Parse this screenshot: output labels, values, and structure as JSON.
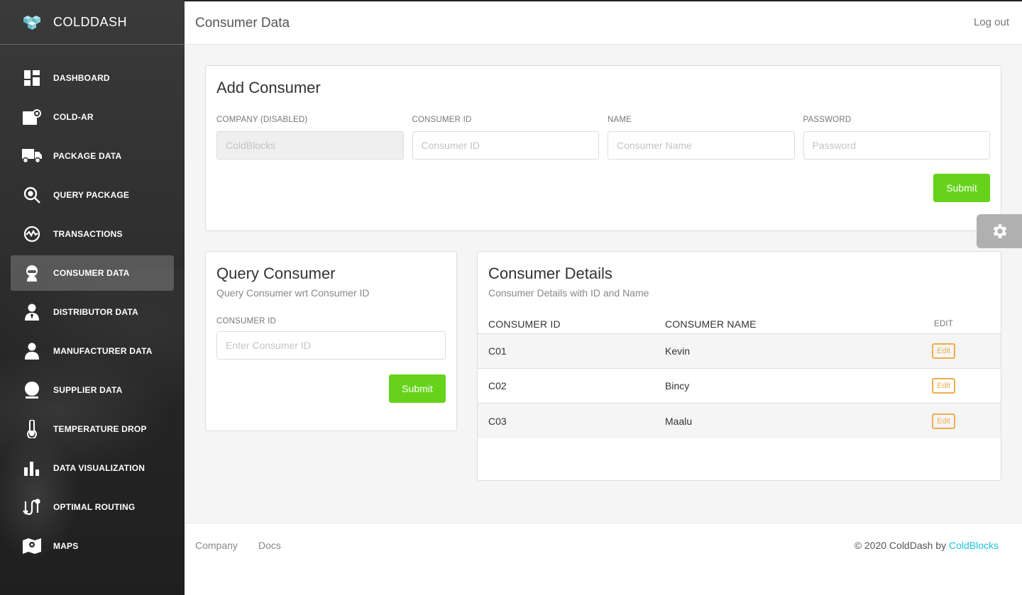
{
  "brand": {
    "name": "COLDDASH"
  },
  "sidebar": {
    "items": [
      {
        "label": "DASHBOARD",
        "icon": "dashboard-icon",
        "active": false
      },
      {
        "label": "COLD-AR",
        "icon": "ar-icon",
        "active": false
      },
      {
        "label": "PACKAGE DATA",
        "icon": "truck-icon",
        "active": false
      },
      {
        "label": "QUERY PACKAGE",
        "icon": "search-icon",
        "active": false
      },
      {
        "label": "TRANSACTIONS",
        "icon": "transactions-icon",
        "active": false
      },
      {
        "label": "CONSUMER DATA",
        "icon": "consumer-icon",
        "active": true
      },
      {
        "label": "DISTRIBUTOR DATA",
        "icon": "distributor-icon",
        "active": false
      },
      {
        "label": "MANUFACTURER DATA",
        "icon": "manufacturer-icon",
        "active": false
      },
      {
        "label": "SUPPLIER DATA",
        "icon": "supplier-icon",
        "active": false
      },
      {
        "label": "TEMPERATURE DROP",
        "icon": "thermometer-icon",
        "active": false
      },
      {
        "label": "DATA VISUALIZATION",
        "icon": "bar-chart-icon",
        "active": false
      },
      {
        "label": "OPTIMAL ROUTING",
        "icon": "routing-icon",
        "active": false
      },
      {
        "label": "MAPS",
        "icon": "map-icon",
        "active": false
      }
    ]
  },
  "header": {
    "title": "Consumer Data",
    "logout": "Log out"
  },
  "add_consumer": {
    "title": "Add Consumer",
    "fields": {
      "company": {
        "label": "COMPANY (DISABLED)",
        "placeholder": "ColdBlocks"
      },
      "consumer_id": {
        "label": "CONSUMER ID",
        "placeholder": "Consumer ID"
      },
      "name": {
        "label": "NAME",
        "placeholder": "Consumer Name"
      },
      "password": {
        "label": "PASSWORD",
        "placeholder": "Password"
      }
    },
    "submit": "Submit"
  },
  "query_consumer": {
    "title": "Query Consumer",
    "subtitle": "Query Consumer wrt Consumer ID",
    "field_label": "CONSUMER ID",
    "placeholder": "Enter Consumer ID",
    "submit": "Submit"
  },
  "consumer_details": {
    "title": "Consumer Details",
    "subtitle": "Consumer Details with ID and Name",
    "columns": [
      "CONSUMER ID",
      "CONSUMER NAME",
      "EDIT"
    ],
    "rows": [
      {
        "id": "C01",
        "name": "Kevin",
        "edit": "Edit"
      },
      {
        "id": "C02",
        "name": "Bincy",
        "edit": "Edit"
      },
      {
        "id": "C03",
        "name": "Maalu",
        "edit": "Edit"
      }
    ]
  },
  "footer": {
    "links": [
      "Company",
      "Docs"
    ],
    "copyright": "© 2020 ColdDash by ",
    "copyright_link": "ColdBlocks"
  },
  "colors": {
    "accent_green": "#66d31a",
    "edit_orange": "#f0ad4e",
    "link_cyan": "#1ec0e0",
    "sidebar_bg": "#2f2f2f"
  }
}
